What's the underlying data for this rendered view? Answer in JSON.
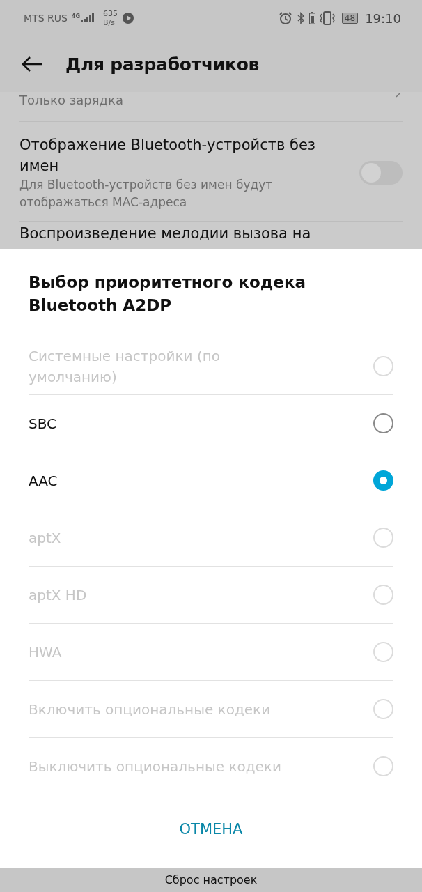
{
  "status_bar": {
    "carrier": "MTS RUS",
    "network": "4G",
    "speed_value": "635",
    "speed_unit": "B/s",
    "battery": "48",
    "time": "19:10"
  },
  "header": {
    "title": "Для разработчиков"
  },
  "settings": [
    {
      "kind": "summary",
      "summary": "Только зарядка"
    },
    {
      "kind": "toggle",
      "title": "Отображение Bluetooth-устройств без имен",
      "summary": "Для Bluetooth-устройств без имен будут отображаться MAC-адреса",
      "on": false
    },
    {
      "kind": "title",
      "title": "Воспроизведение мелодии вызова на"
    }
  ],
  "dialog": {
    "title": "Выбор приоритетного кодека Bluetooth A2DP",
    "options": [
      {
        "label": "Системные настройки (по умолчанию)",
        "selected": false,
        "disabled": true
      },
      {
        "label": "SBC",
        "selected": false,
        "disabled": false
      },
      {
        "label": "AAC",
        "selected": true,
        "disabled": false
      },
      {
        "label": "aptX",
        "selected": false,
        "disabled": true
      },
      {
        "label": "aptX HD",
        "selected": false,
        "disabled": true
      },
      {
        "label": "HWA",
        "selected": false,
        "disabled": true
      },
      {
        "label": "Включить опциональные кодеки",
        "selected": false,
        "disabled": true
      },
      {
        "label": "Выключить опциональные кодеки",
        "selected": false,
        "disabled": true
      }
    ],
    "cancel": "ОТМЕНА"
  },
  "bottom_bar": {
    "label": "Сброс настроек"
  }
}
